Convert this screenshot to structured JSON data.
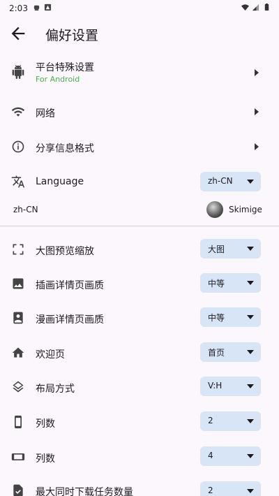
{
  "status_bar": {
    "time": "2:03"
  },
  "app_bar": {
    "title": "偏好设置"
  },
  "nav_items": [
    {
      "label": "平台特殊设置",
      "subtitle": "For Android"
    },
    {
      "label": "网络"
    },
    {
      "label": "分享信息格式"
    }
  ],
  "language": {
    "label": "Language",
    "value": "zh-CN"
  },
  "account": {
    "locale": "zh-CN",
    "username": "Skimige"
  },
  "settings": [
    {
      "label": "大图预览缩放",
      "value": "大图"
    },
    {
      "label": "插画详情页画质",
      "value": "中等"
    },
    {
      "label": "漫画详情页画质",
      "value": "中等"
    },
    {
      "label": "欢迎页",
      "value": "首页"
    },
    {
      "label": "布局方式",
      "value": "V:H"
    },
    {
      "label": "列数",
      "value": "2"
    },
    {
      "label": "列数",
      "value": "4"
    },
    {
      "label": "最大同时下载任务数量",
      "value": "2"
    }
  ],
  "colors": {
    "background": "#FCF7FD",
    "dropdown": "#D8E5F7",
    "subtitle": "#4CAF50"
  }
}
